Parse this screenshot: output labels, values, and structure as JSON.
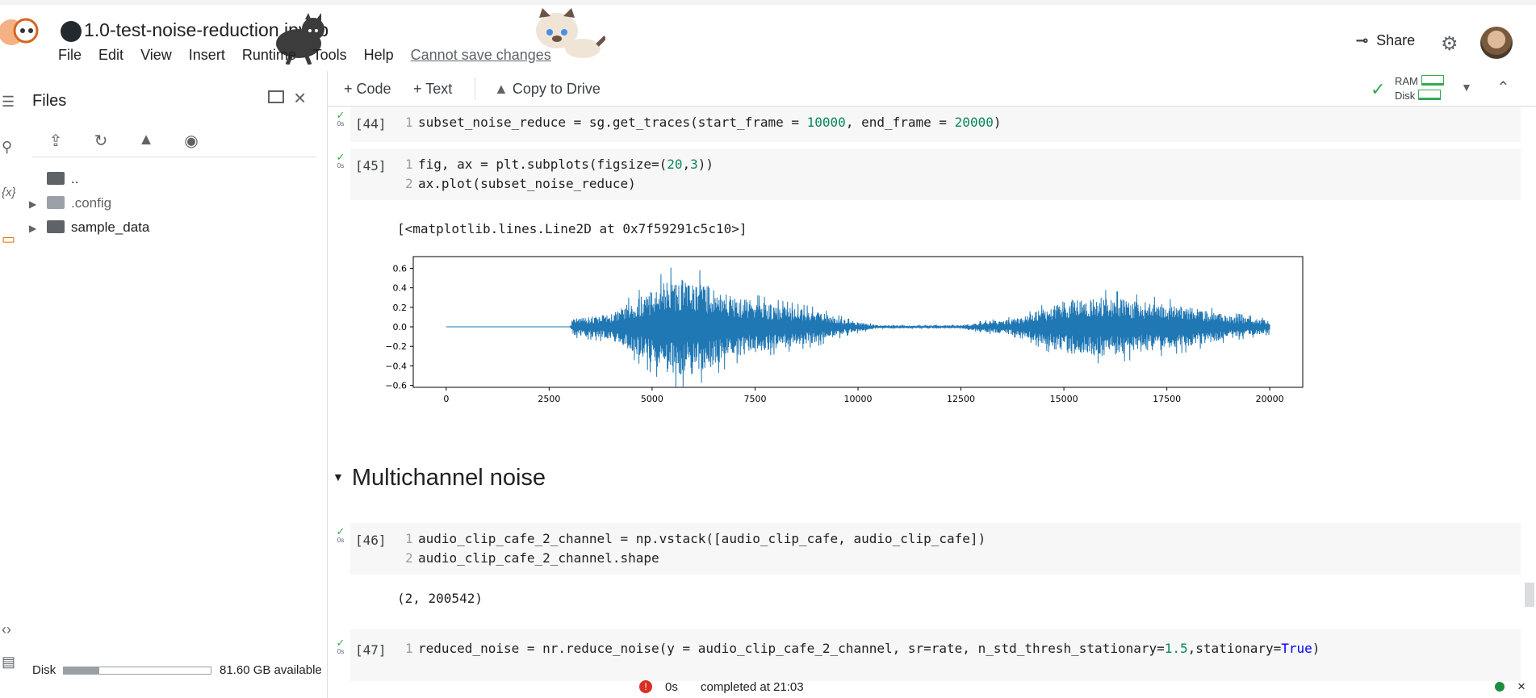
{
  "app": {
    "notebook_title": "1.0-test-noise-reduction.ipynb",
    "menu": [
      "File",
      "Edit",
      "View",
      "Insert",
      "Runtime",
      "Tools",
      "Help"
    ],
    "cannot_save": "Cannot save changes",
    "share_label": "Share",
    "icons": {
      "github": "github-icon",
      "share": "link-icon",
      "settings": "gear-icon"
    }
  },
  "sidebar": {
    "title": "Files",
    "toolbar_icons": [
      "upload-file-icon",
      "refresh-folder-icon",
      "mount-drive-icon",
      "visibility-icon"
    ],
    "tree": [
      {
        "label": "..",
        "icon": "folder-up-icon",
        "expandable": false
      },
      {
        "label": ".config",
        "icon": "folder-icon",
        "expandable": true,
        "dimmed": true
      },
      {
        "label": "sample_data",
        "icon": "folder-icon",
        "expandable": true,
        "dimmed": false
      }
    ],
    "disk_label": "Disk",
    "disk_used_fraction": 0.24,
    "disk_available": "81.60 GB available"
  },
  "toolbar": {
    "code_label": "Code",
    "text_label": "Text",
    "copy_to_drive_label": "Copy to Drive",
    "ram_label": "RAM",
    "disk_label": "Disk"
  },
  "cells": [
    {
      "exec": "[44]",
      "time": "0s",
      "lines": [
        {
          "n": "1",
          "parts": [
            [
              "t",
              "subset_noise_reduce = sg.get_traces(start_frame = "
            ],
            [
              "num",
              "10000"
            ],
            [
              "t",
              ", end_frame = "
            ],
            [
              "num",
              "20000"
            ],
            [
              "t",
              ")"
            ]
          ]
        }
      ]
    },
    {
      "exec": "[45]",
      "time": "0s",
      "lines": [
        {
          "n": "1",
          "parts": [
            [
              "t",
              "fig, ax = plt.subplots(figsize=("
            ],
            [
              "num",
              "20"
            ],
            [
              "t",
              ","
            ],
            [
              "num",
              "3"
            ],
            [
              "t",
              "))"
            ]
          ]
        },
        {
          "n": "2",
          "parts": [
            [
              "t",
              "ax.plot(subset_noise_reduce)"
            ]
          ]
        }
      ],
      "output": "[<matplotlib.lines.Line2D at 0x7f59291c5c10>]"
    },
    {
      "exec": "[46]",
      "time": "0s",
      "lines": [
        {
          "n": "1",
          "parts": [
            [
              "t",
              "audio_clip_cafe_2_channel = np.vstack([audio_clip_cafe, audio_clip_cafe])"
            ]
          ]
        },
        {
          "n": "2",
          "parts": [
            [
              "t",
              "audio_clip_cafe_2_channel.shape"
            ]
          ]
        }
      ],
      "output": "(2, 200542)"
    },
    {
      "exec": "[47]",
      "time": "0s",
      "lines": [
        {
          "n": "1",
          "parts": [
            [
              "t",
              "reduced_noise = nr.reduce_noise(y = audio_clip_cafe_2_channel, sr=rate, n_std_thresh_stationary="
            ],
            [
              "num",
              "1.5"
            ],
            [
              "t",
              ",stationary="
            ],
            [
              "kw",
              "True"
            ],
            [
              "t",
              ")"
            ]
          ]
        }
      ]
    }
  ],
  "section_heading": "Multichannel noise",
  "status": {
    "time": "0s",
    "completed": "completed at 21:03"
  },
  "chart_data": {
    "type": "line",
    "xlim": [
      -800,
      20800
    ],
    "ylim": [
      -0.62,
      0.72
    ],
    "xticks": [
      0,
      2500,
      5000,
      7500,
      10000,
      12500,
      15000,
      17500,
      20000
    ],
    "yticks": [
      0.6,
      0.4,
      0.2,
      0.0,
      -0.2,
      -0.4,
      -0.6
    ],
    "ytick_labels": [
      "0.6",
      "0.4",
      "0.2",
      "0.0",
      "−0.2",
      "−0.4",
      "−0.6"
    ],
    "color": "#1f77b4",
    "envelope": [
      {
        "x": 0,
        "amp": 0.0
      },
      {
        "x": 3000,
        "amp": 0.0
      },
      {
        "x": 3100,
        "amp": 0.11
      },
      {
        "x": 4000,
        "amp": 0.16
      },
      {
        "x": 4500,
        "amp": 0.32
      },
      {
        "x": 5000,
        "amp": 0.48
      },
      {
        "x": 5500,
        "amp": 0.62
      },
      {
        "x": 6000,
        "amp": 0.62
      },
      {
        "x": 6500,
        "amp": 0.5
      },
      {
        "x": 7000,
        "amp": 0.38
      },
      {
        "x": 8000,
        "amp": 0.28
      },
      {
        "x": 9000,
        "amp": 0.2
      },
      {
        "x": 9800,
        "amp": 0.08
      },
      {
        "x": 10500,
        "amp": 0.02
      },
      {
        "x": 12500,
        "amp": 0.02
      },
      {
        "x": 13000,
        "amp": 0.06
      },
      {
        "x": 14000,
        "amp": 0.12
      },
      {
        "x": 15000,
        "amp": 0.34
      },
      {
        "x": 16000,
        "amp": 0.38
      },
      {
        "x": 17000,
        "amp": 0.32
      },
      {
        "x": 18000,
        "amp": 0.26
      },
      {
        "x": 19000,
        "amp": 0.15
      },
      {
        "x": 20000,
        "amp": 0.08
      }
    ]
  }
}
